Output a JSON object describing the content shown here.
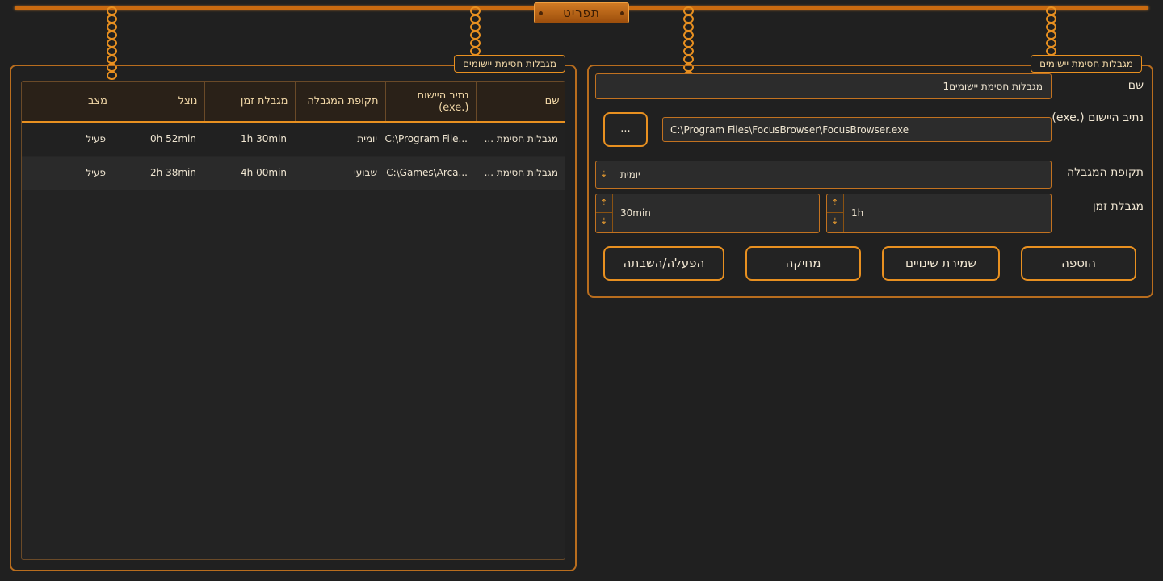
{
  "app": {
    "menu_label": "תפריט"
  },
  "left_panel": {
    "title": "מגבלות חסימת יישומים",
    "columns": [
      "שם",
      "נתיב היישום (.exe)",
      "תקופת המגבלה",
      "מגבלת זמן",
      "נוצל",
      "מצב"
    ],
    "rows": [
      [
        "מגבלות חסימת ...",
        "...C:\\Program File",
        "יומית",
        "1h 30min",
        "0h 52min",
        "פעיל"
      ],
      [
        "מגבלות חסימת ...",
        "...C:\\Games\\Arca",
        "שבועי",
        "4h 00min",
        "2h 38min",
        "פעיל"
      ]
    ]
  },
  "right_panel": {
    "title": "מגבלות חסימת יישומים",
    "name_label": "שם",
    "name_value": "מגבלות חסימת יישומים1",
    "path_label": "נתיב היישום (.exe)",
    "path_value": "C:\\Program Files\\FocusBrowser\\FocusBrowser.exe",
    "browse_label": "...",
    "period_label": "תקופת המגבלה",
    "period_value": "יומית",
    "limit_label": "מגבלת זמן",
    "hours_value": "1h",
    "minutes_value": "30min",
    "buttons": {
      "add": "הוספה",
      "save": "שמירת שינויים",
      "delete": "מחיקה",
      "toggle": "הפעלה/השבתה"
    }
  },
  "colors": {
    "accent": "#e89020",
    "background": "#202020",
    "border": "#b86d1e"
  }
}
